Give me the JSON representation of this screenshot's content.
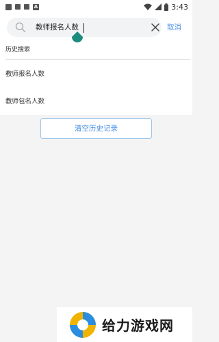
{
  "status_bar": {
    "time": "3:43"
  },
  "search": {
    "query": "教师报名人数",
    "cancel_label": "取消"
  },
  "history": {
    "title": "历史搜索",
    "items": [
      {
        "label": "教师报名人数"
      },
      {
        "label": "教师包名人数"
      }
    ],
    "clear_label": "清空历史记录"
  },
  "watermark": {
    "text": "给力游戏网"
  },
  "colors": {
    "accent": "#4a90e2",
    "cursor_handle": "#1a8c7e",
    "background": "#f4f4f4"
  }
}
